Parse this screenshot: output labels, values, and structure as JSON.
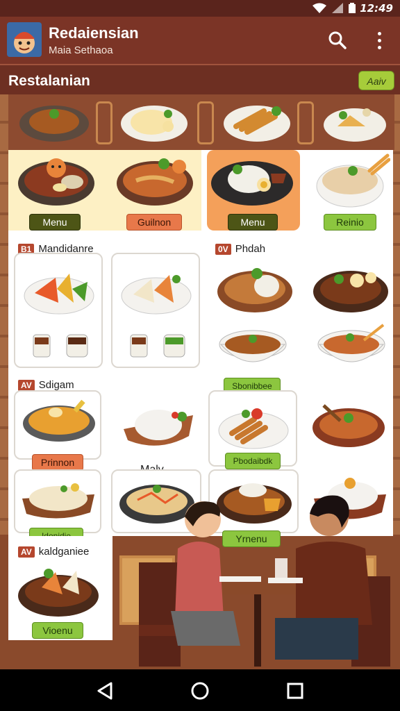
{
  "status_bar": {
    "time": "12:49"
  },
  "app_bar": {
    "title": "Redaiensian",
    "subtitle": "Maia Sethaoa"
  },
  "section": {
    "title": "Restalanian",
    "action_label": "Aaiv"
  },
  "grid": {
    "row1": [
      "Menu",
      "Guilnon",
      "Menu",
      "Reinio"
    ],
    "sections": [
      {
        "badge": "B1",
        "title": "Mandidanre"
      },
      {
        "badge": "0V",
        "title": "Phdah"
      },
      {
        "badge": "AV",
        "title": "Sdigam"
      },
      {
        "badge": "AV",
        "title": "kaldganiee"
      }
    ],
    "labels": {
      "bowl_row_a": "Sbonibbee",
      "dish_row_b": "Prinnon",
      "dish_row_b2": "Pbodaibdk",
      "float_label": "Malv",
      "dish_row_c": "Idonidie",
      "dish_row_c2": "Yrnenu",
      "last_label": "Vioenu"
    }
  },
  "colors": {
    "appbar": "#7b3426",
    "accent_green": "#8cc63f",
    "accent_orange": "#e8784a"
  }
}
